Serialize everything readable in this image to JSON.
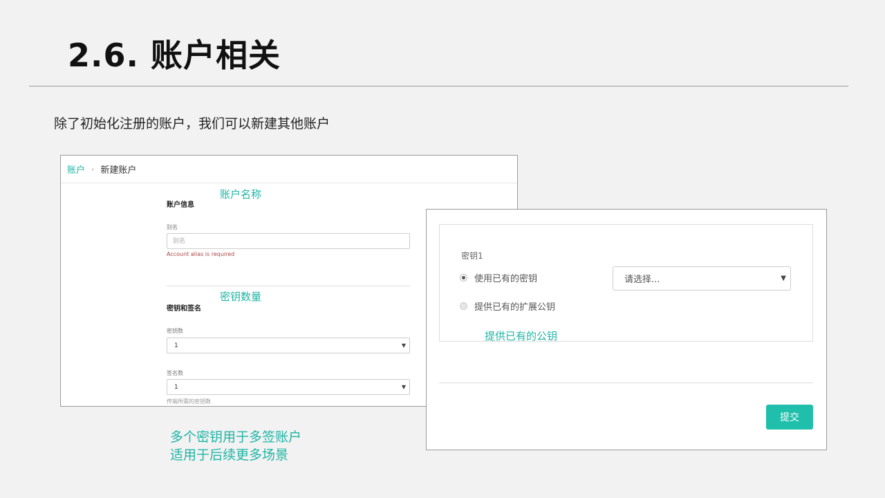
{
  "slide": {
    "title": "2.6. 账户相关",
    "intro": "除了初始化注册的账户，我们可以新建其他账户"
  },
  "annotations": {
    "account_name": "账户名称",
    "key_count": "密钥数量",
    "provide_pubkey": "提供已有的公钥",
    "multisig_line1": "多个密钥用于多签账户",
    "multisig_line2": "适用于后续更多场景"
  },
  "left_window": {
    "breadcrumb": {
      "parent": "账户",
      "current": "新建账户"
    },
    "account_info": {
      "section_title": "账户信息",
      "alias_label": "别名",
      "alias_placeholder": "别名",
      "alias_value": "",
      "alias_error": "Account alias is required"
    },
    "keys_and_signatures": {
      "section_title": "密钥和签名",
      "key_count_label": "密钥数",
      "key_count_value": "1",
      "signature_count_label": "签名数",
      "signature_count_value": "1",
      "signature_hint": "传输所需的密钥数"
    }
  },
  "right_window": {
    "key_label": "密钥1",
    "option_existing": "使用已有的密钥",
    "option_extended": "提供已有的扩展公钥",
    "key_select_value": "请选择...",
    "submit": "提交"
  },
  "colors": {
    "accent": "#1fb5a5",
    "submit_button": "#1fbfab",
    "error": "#a94442",
    "background": "#f2f2f2"
  },
  "icons": {
    "breadcrumb_separator": "chevron-right-icon",
    "select_caret": "caret-down-icon"
  }
}
